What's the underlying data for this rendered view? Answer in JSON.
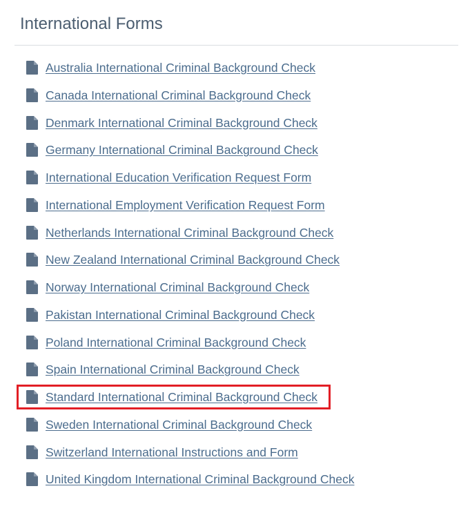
{
  "section": {
    "title": "International Forms"
  },
  "forms": [
    {
      "label": "Australia International Criminal Background Check"
    },
    {
      "label": "Canada International Criminal Background Check"
    },
    {
      "label": "Denmark International Criminal Background Check"
    },
    {
      "label": "Germany International Criminal Background Check"
    },
    {
      "label": "International Education Verification Request Form"
    },
    {
      "label": "International Employment Verification Request Form"
    },
    {
      "label": "Netherlands International Criminal Background Check"
    },
    {
      "label": "New Zealand International Criminal Background Check"
    },
    {
      "label": "Norway International Criminal Background Check"
    },
    {
      "label": "Pakistan International Criminal Background Check"
    },
    {
      "label": "Poland International Criminal Background Check"
    },
    {
      "label": "Spain International Criminal Background Check"
    },
    {
      "label": "Standard International Criminal Background Check",
      "highlighted": true
    },
    {
      "label": "Sweden International Criminal Background Check"
    },
    {
      "label": "Switzerland International Instructions and Form"
    },
    {
      "label": "United Kingdom International Criminal Background Check"
    }
  ],
  "icon": "document-icon",
  "colors": {
    "title": "#4b5d70",
    "link": "#4b6c8d",
    "icon": "#5b6f85",
    "divider": "#d9dde1",
    "highlight": "#e21e25"
  }
}
